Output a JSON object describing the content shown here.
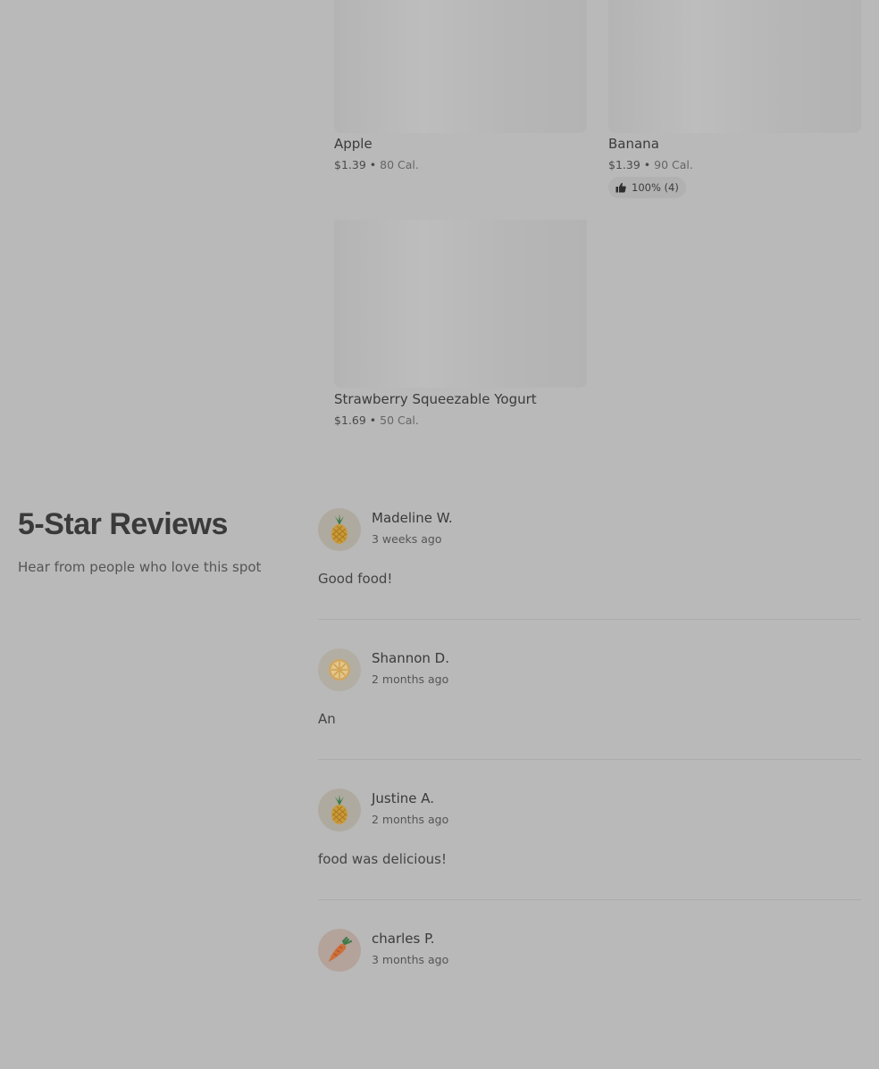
{
  "menu_items": [
    {
      "name": "Apple",
      "price": "$1.39",
      "separator": "•",
      "calories": "80 Cal."
    },
    {
      "name": "Banana",
      "price": "$1.39",
      "separator": "•",
      "calories": "90 Cal.",
      "rating": "100% (4)",
      "rating_icon": "thumbs-up-icon"
    },
    {
      "name": "Strawberry Squeezable Yogurt",
      "price": "$1.69",
      "separator": "•",
      "calories": "50 Cal."
    }
  ],
  "reviews_section": {
    "title": "5-Star Reviews",
    "subtitle": "Hear from people who love this spot"
  },
  "reviews": [
    {
      "name": "Madeline W.",
      "time": "3 weeks ago",
      "text": "Good food!",
      "avatar_icon": "pineapple-icon"
    },
    {
      "name": "Shannon D.",
      "time": "2 months ago",
      "text": "An",
      "avatar_icon": "lemon-slice-icon"
    },
    {
      "name": "Justine A.",
      "time": "2 months ago",
      "text": "food was delicious!",
      "avatar_icon": "pineapple-icon"
    },
    {
      "name": "charles P.",
      "time": "3 months ago",
      "text": "",
      "avatar_icon": "carrot-icon"
    }
  ]
}
